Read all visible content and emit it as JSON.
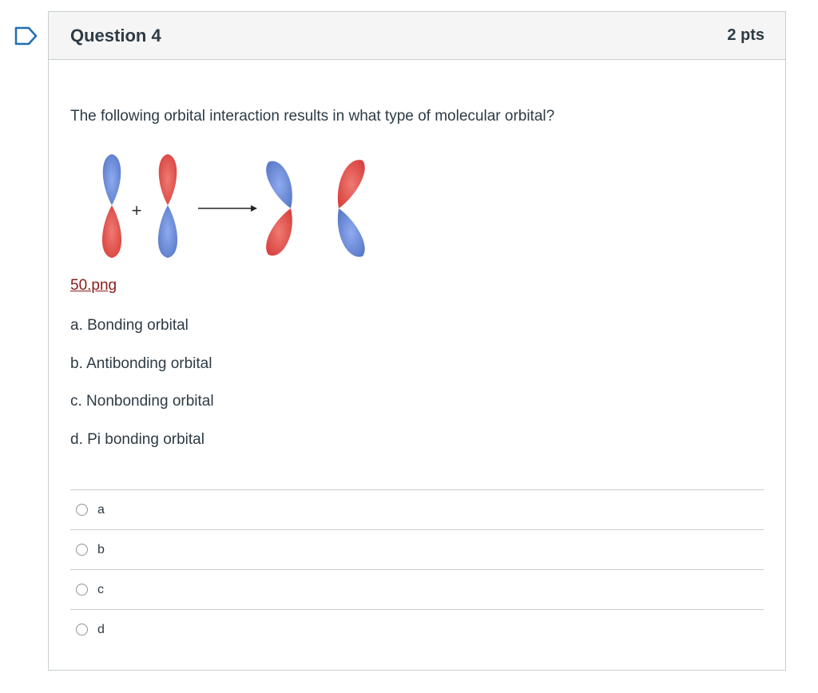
{
  "question": {
    "title": "Question 4",
    "points": "2 pts",
    "prompt": "The following orbital interaction results in what type of molecular orbital?",
    "image_link": "50.png",
    "choices_text": [
      "a. Bonding orbital",
      "b. Antibonding orbital",
      "c. Nonbonding orbital",
      "d. Pi bonding orbital"
    ],
    "answers": [
      "a",
      "b",
      "c",
      "d"
    ],
    "diagram": {
      "plus_sign": "+",
      "colors": {
        "blue": "#6f8fd8",
        "red": "#e0534f"
      }
    }
  },
  "colors": {
    "flag": "#1f6fb5",
    "link": "#8b1a1a",
    "border": "#c7cdd1"
  }
}
